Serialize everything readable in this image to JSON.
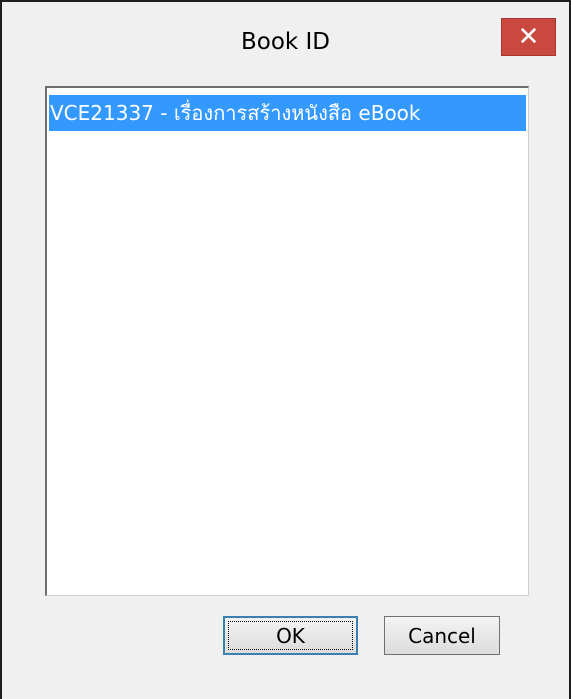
{
  "window": {
    "title": "Book ID",
    "close_symbol": "✕"
  },
  "list": {
    "items": [
      {
        "label": "VCE21337 - เรื่องการสร้างหนังสือ eBook",
        "selected": true
      }
    ]
  },
  "buttons": {
    "ok_label": "OK",
    "cancel_label": "Cancel"
  },
  "colors": {
    "selection": "#3399ff",
    "close_button": "#c9483f"
  }
}
